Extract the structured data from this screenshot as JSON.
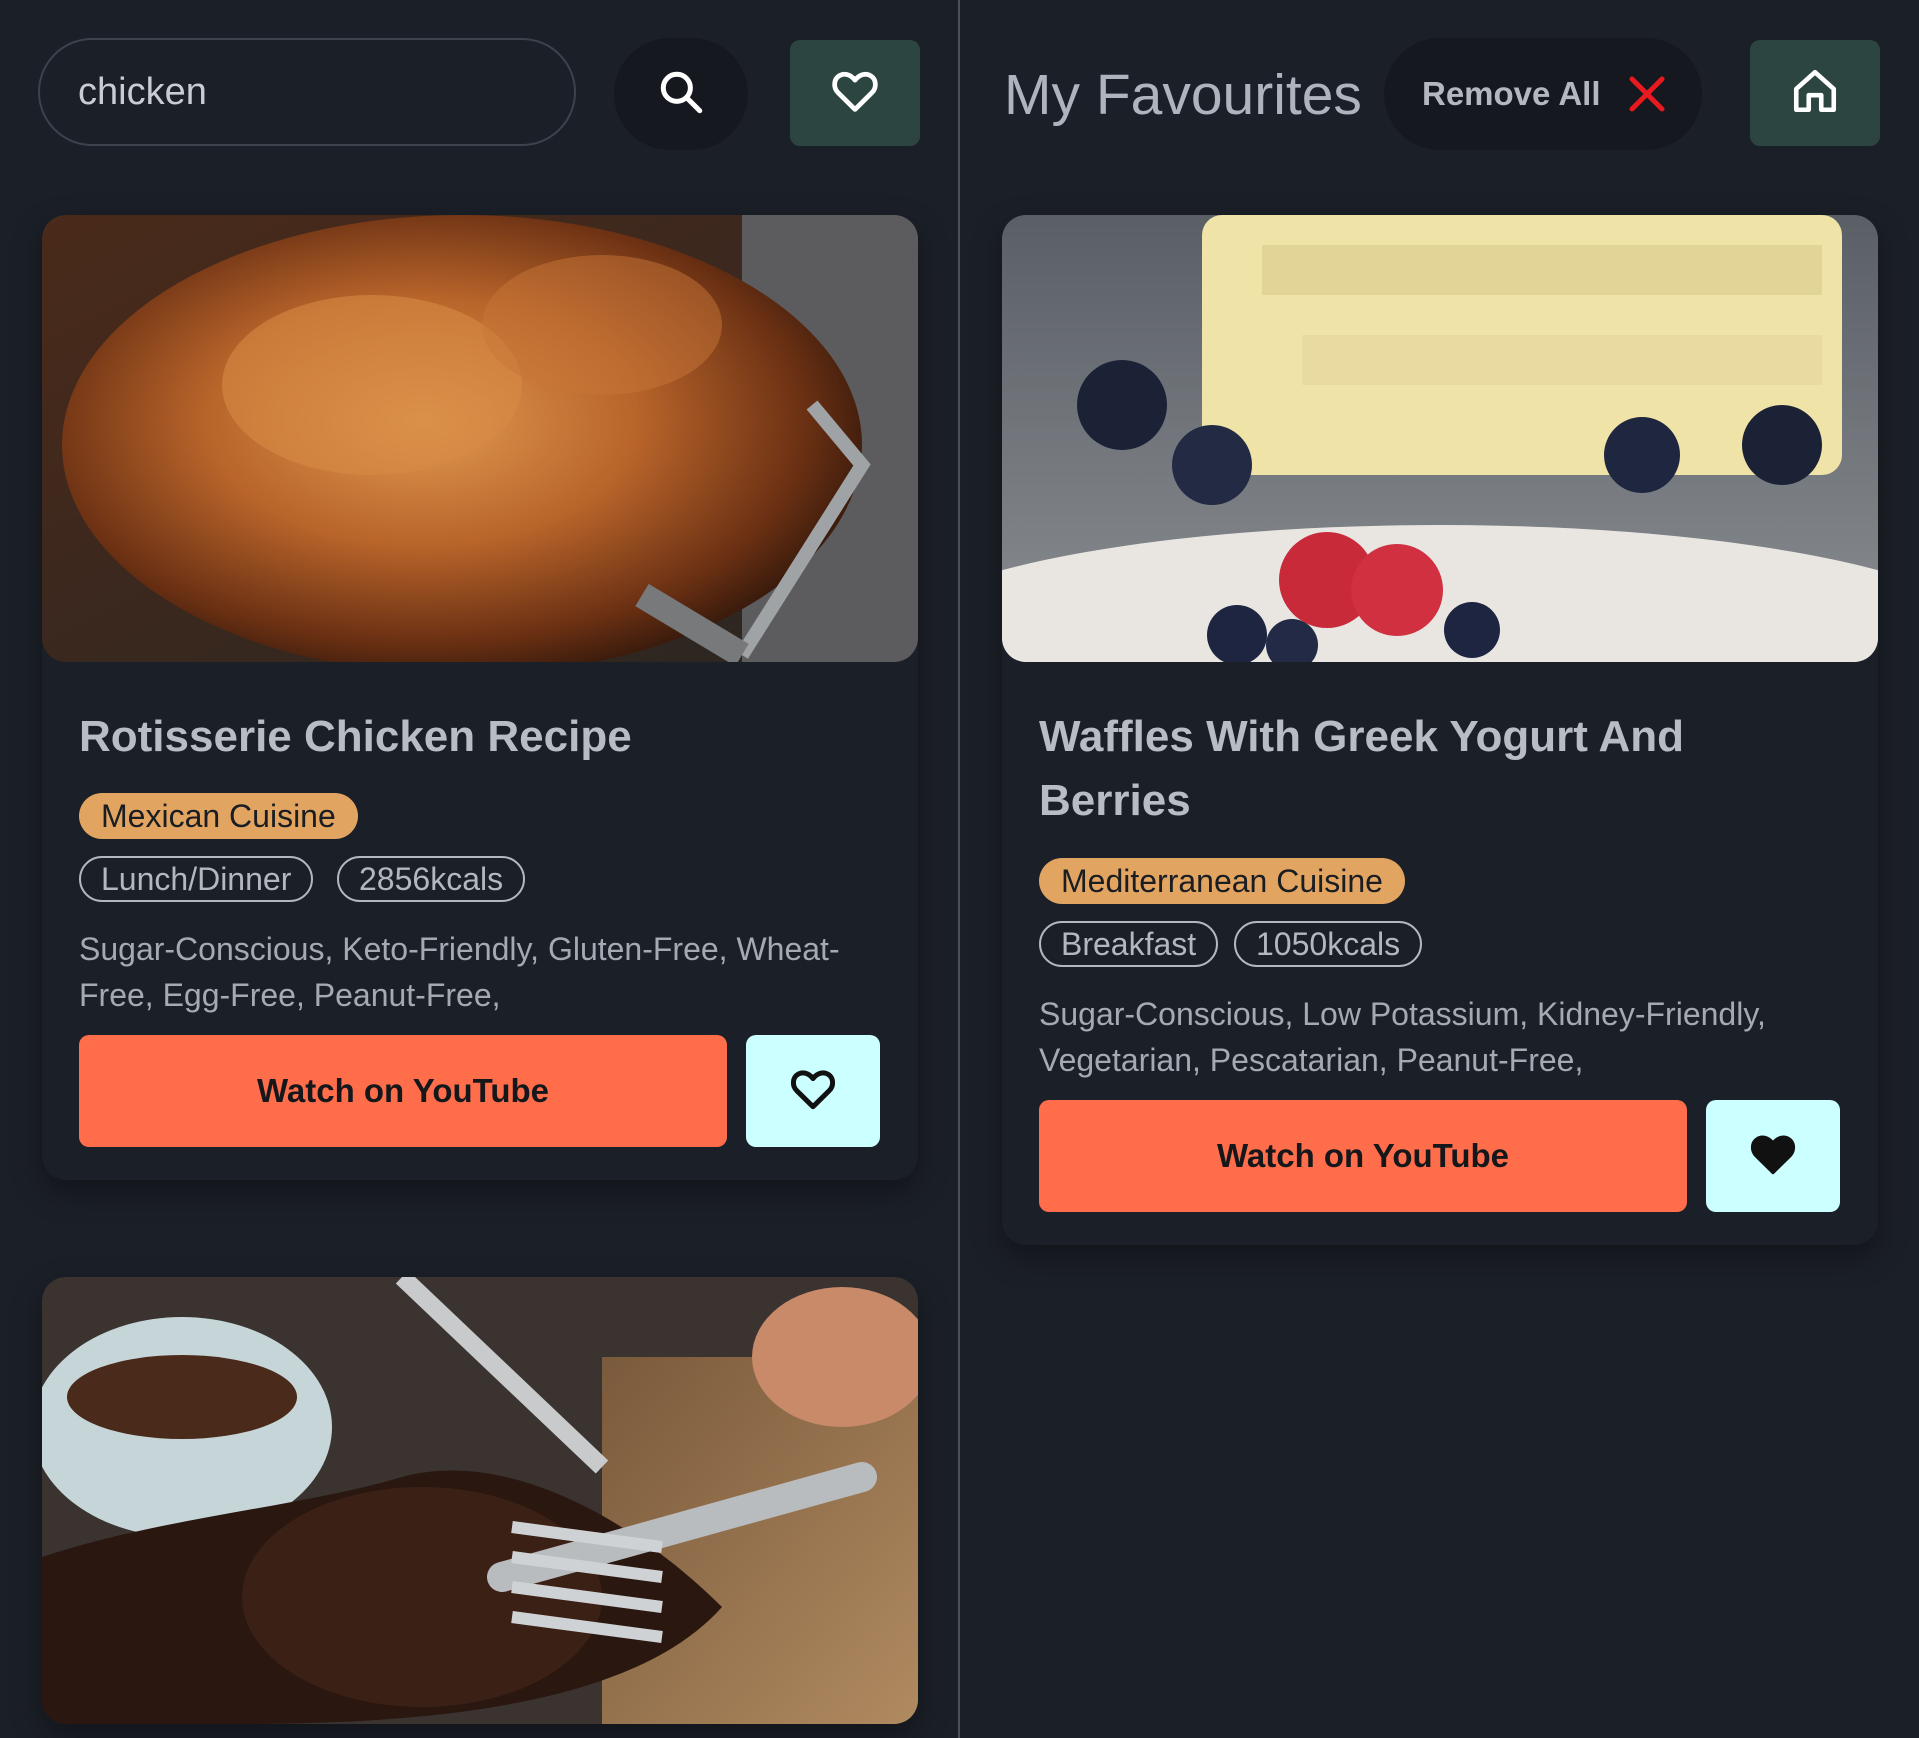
{
  "search": {
    "value": "chicken"
  },
  "favourites": {
    "title": "My Favourites",
    "remove_all_label": "Remove All"
  },
  "results": [
    {
      "title": "Rotisserie Chicken Recipe",
      "cuisine": "Mexican Cuisine",
      "meal_type": "Lunch/Dinner",
      "calories": "2856kcals",
      "health_labels": "Sugar-Conscious, Keto-Friendly, Gluten-Free, Wheat-Free, Egg-Free, Peanut-Free,",
      "youtube_label": "Watch on YouTube",
      "image": "rotisserie-chicken-photo",
      "favourited": false
    },
    {
      "image": "grilled-meat-with-rice-photo"
    }
  ],
  "favourite_items": [
    {
      "title": "Waffles With Greek Yogurt And Berries",
      "cuisine": "Mediterranean Cuisine",
      "meal_type": "Breakfast",
      "calories": "1050kcals",
      "health_labels": "Sugar-Conscious, Low Potassium, Kidney-Friendly, Vegetarian, Pescatarian, Peanut-Free,",
      "youtube_label": "Watch on YouTube",
      "image": "waffles-berries-photo",
      "favourited": true
    }
  ],
  "icons": {
    "search": "search-icon",
    "favourites": "heart-outline-icon",
    "home": "home-icon",
    "remove": "close-icon"
  },
  "colors": {
    "background": "#1b1f27",
    "accent_button": "#ff6d4a",
    "cuisine_tag": "#e2a461",
    "fav_button": "#ccffff",
    "nav_button": "#2d4540",
    "remove_x": "#e8191f"
  }
}
